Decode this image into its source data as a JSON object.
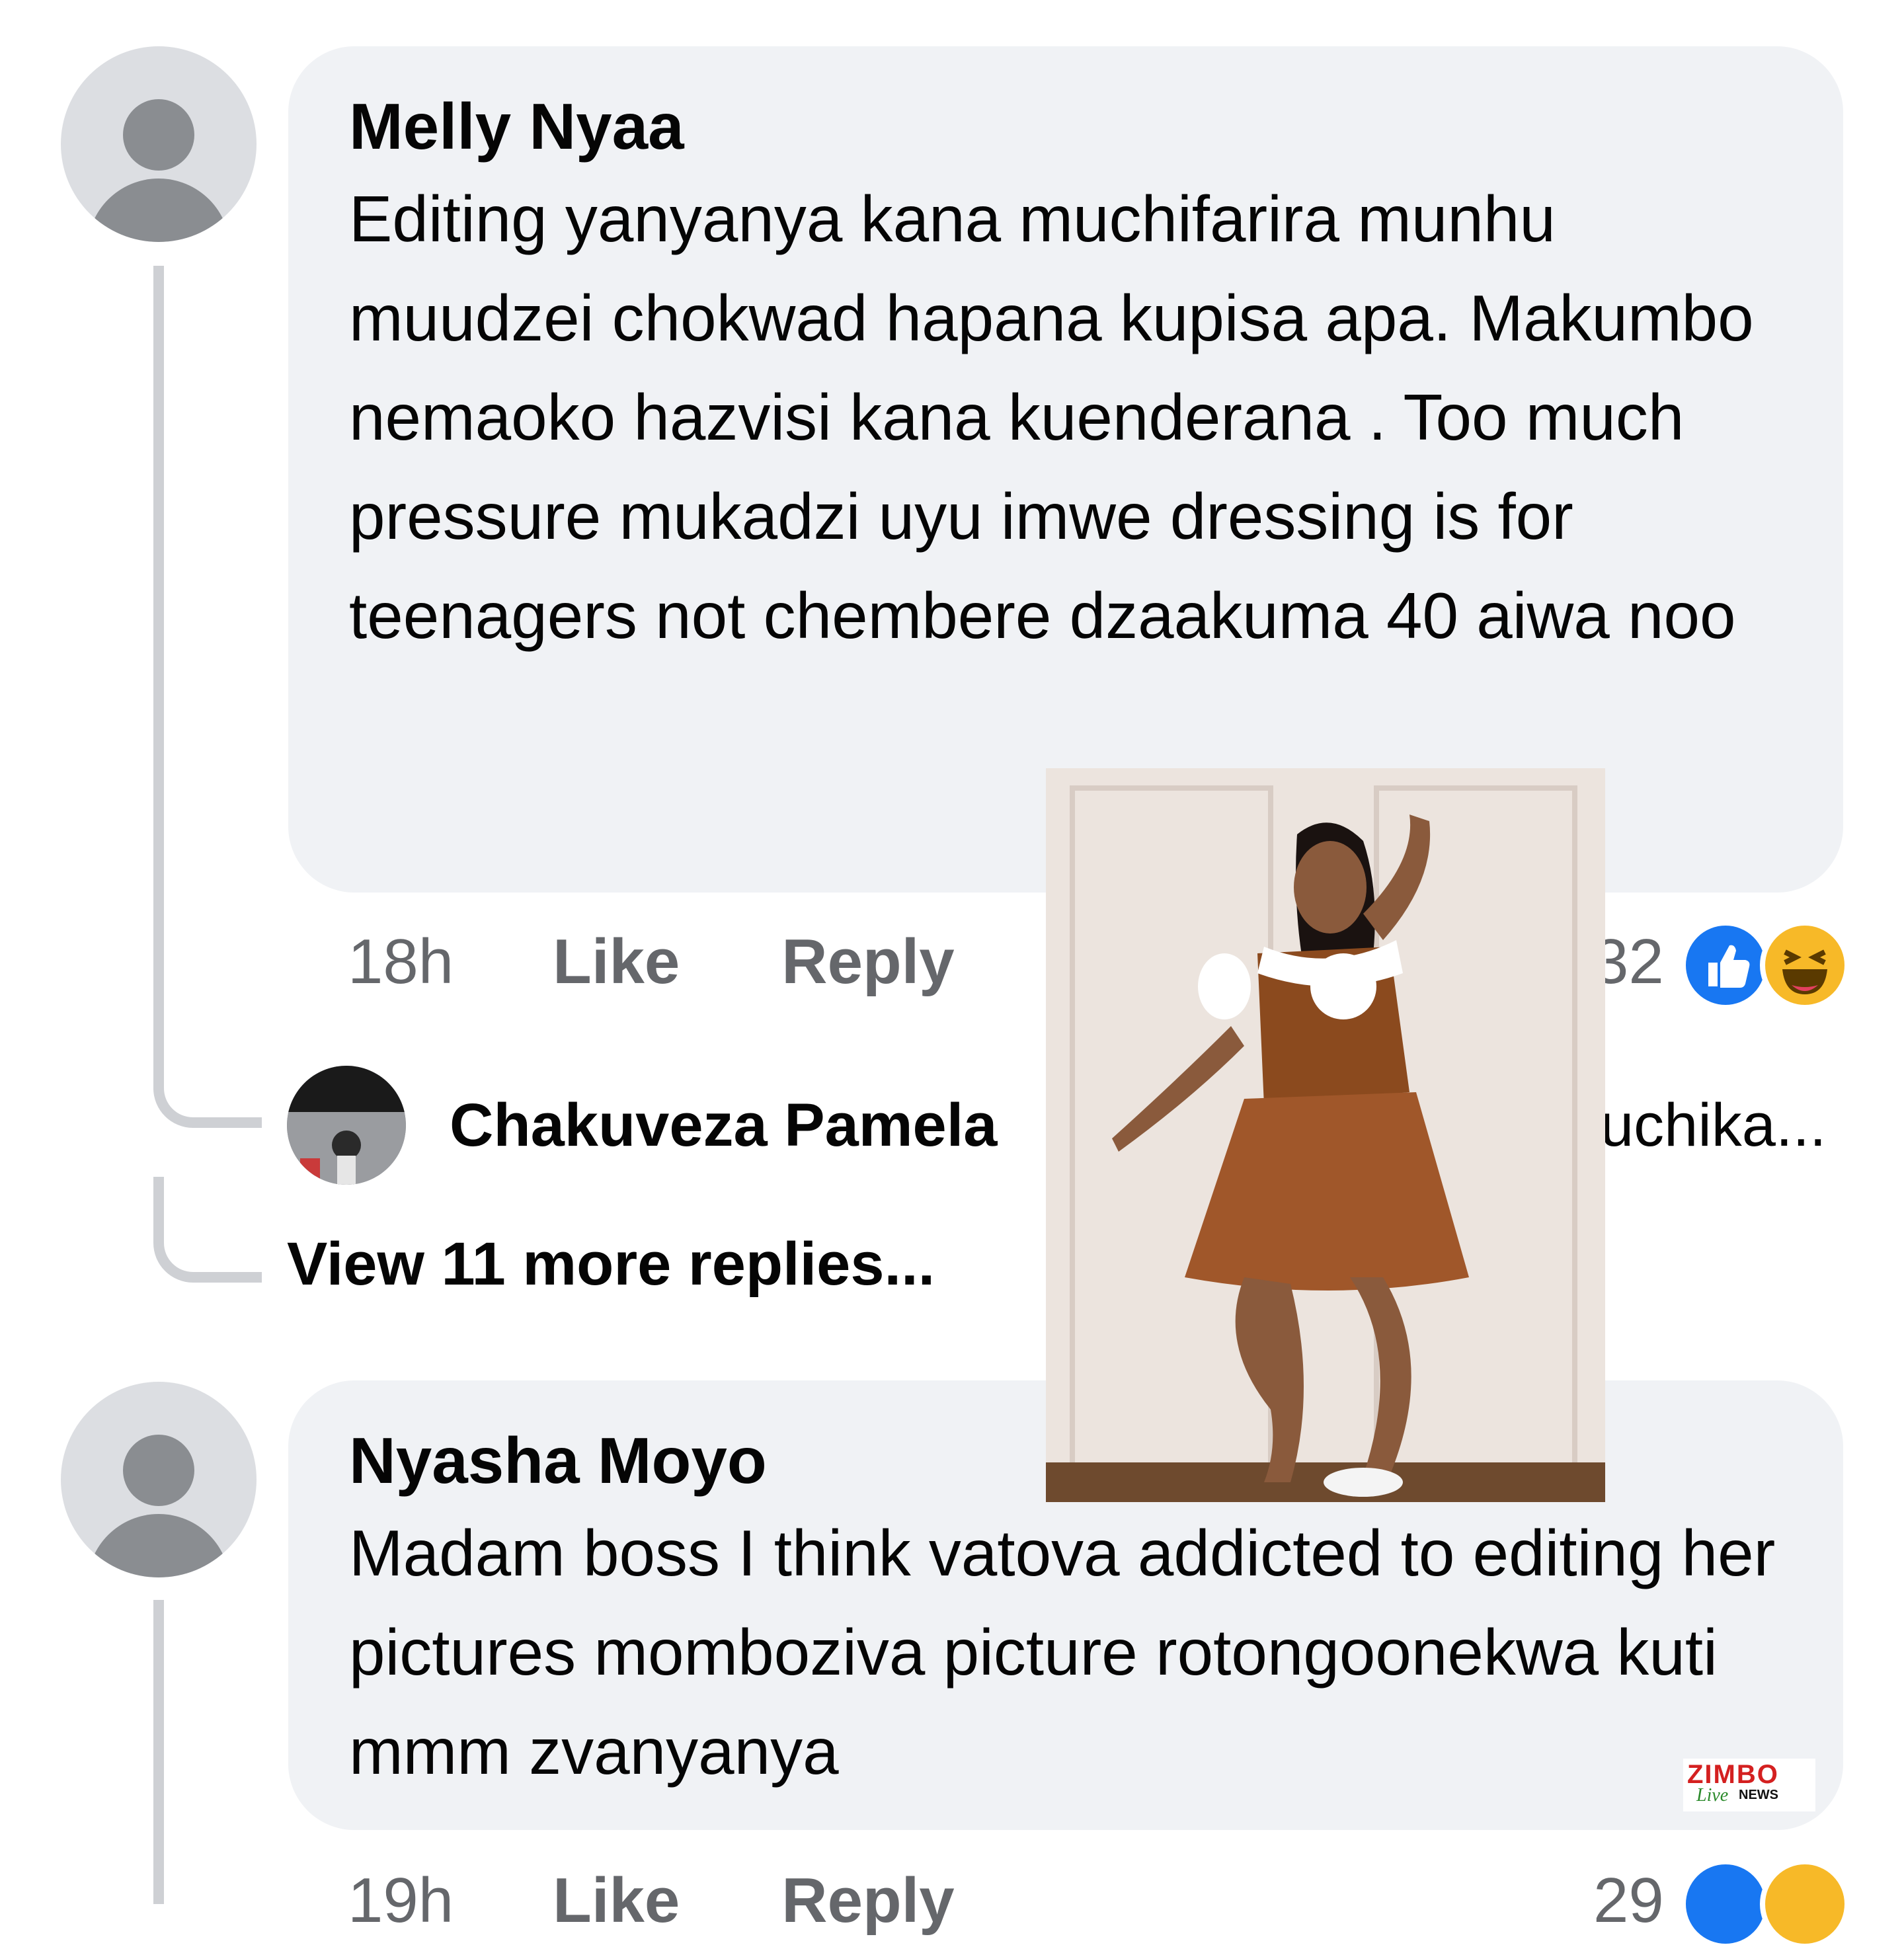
{
  "comments": [
    {
      "author": "Melly Nyaa",
      "text": "Editing yanyanya kana muchifarira munhu muudzei chokwad hapana kupisa apa. Makumbo nemaoko hazvisi kana kuenderana . Too much pressure mukadzi uyu imwe dressing is for teenagers not chembere dzaakuma 40 aiwa noo",
      "time": "18h",
      "like_label": "Like",
      "reply_label": "Reply",
      "reaction_count": "32",
      "reaction_icons": [
        "like-icon",
        "haha-icon"
      ]
    },
    {
      "author": "Nyasha Moyo",
      "text": "Madam boss I think vatova addicted to editing her pictures momboziva picture rotongoonekwa kuti mmm zvanyanya",
      "time": "19h",
      "like_label": "Like",
      "reply_label": "Reply",
      "reaction_count": "29",
      "reaction_icons": [
        "like-icon",
        "haha-icon"
      ]
    }
  ],
  "reply_preview": {
    "author": "Chakuveza Pamela",
    "snippet_end": "uchika..."
  },
  "view_more": "View 11 more replies...",
  "watermark": {
    "line1": "ZIMBO",
    "line2": "Live",
    "line3": "NEWS"
  },
  "colors": {
    "bubble": "#f0f2f5",
    "muted_text": "#65676b",
    "like_blue": "#1877f2",
    "haha_yellow": "#f7b928",
    "thread_line": "#ced0d4"
  }
}
